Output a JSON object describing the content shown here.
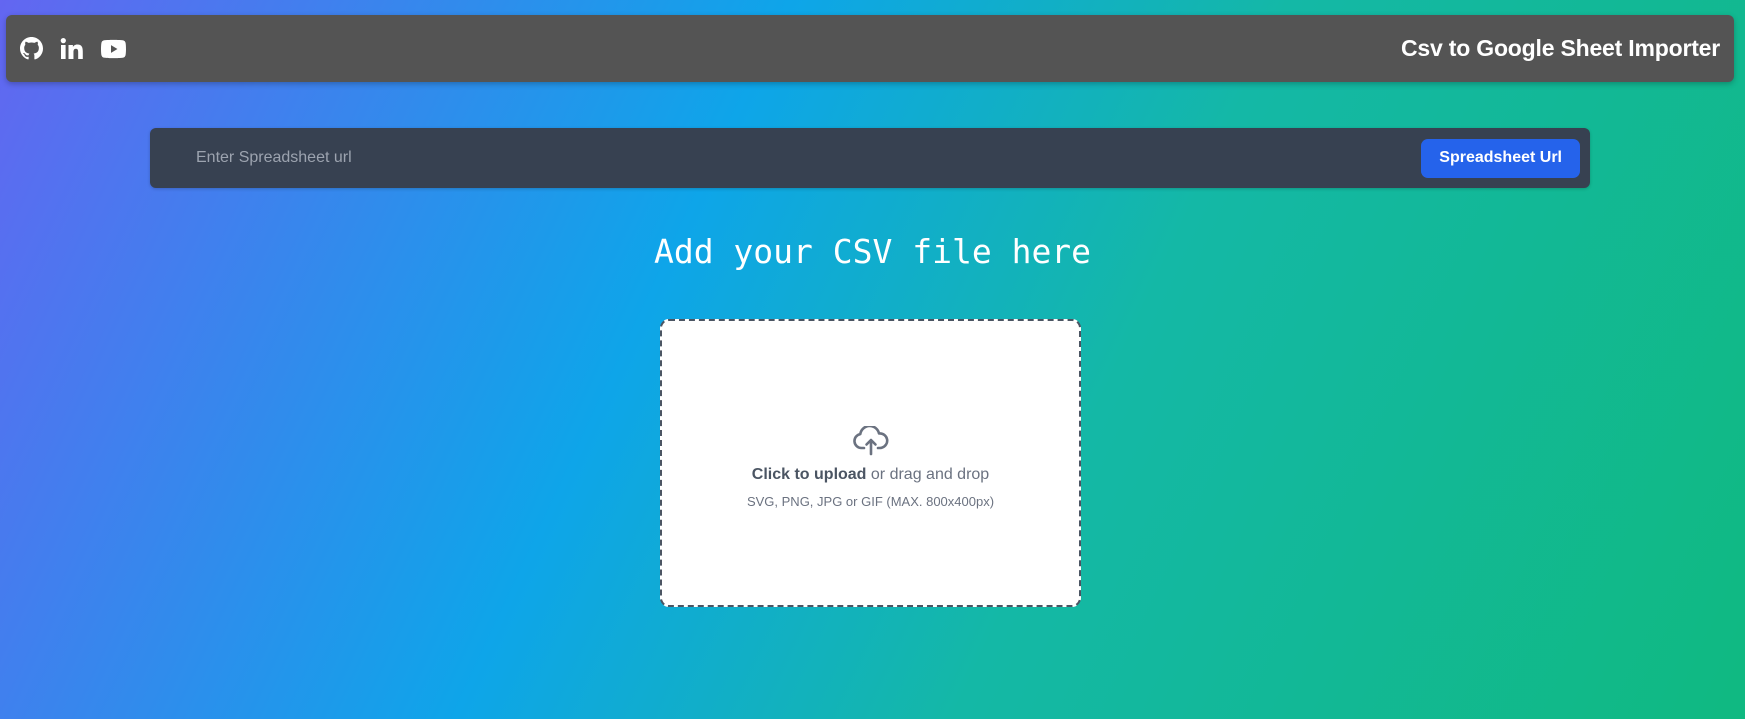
{
  "header": {
    "title": "Csv to Google Sheet Importer",
    "social_icons": [
      "github-icon",
      "linkedin-icon",
      "youtube-icon"
    ]
  },
  "url_bar": {
    "placeholder": "Enter Spreadsheet url",
    "value": "",
    "button_label": "Spreadsheet Url"
  },
  "main": {
    "heading": "Add your CSV file here"
  },
  "dropzone": {
    "icon": "cloud-upload-icon",
    "click_text": "Click to upload",
    "drag_text": " or drag and drop",
    "hint": "SVG, PNG, JPG or GIF (MAX. 800x400px)"
  },
  "colors": {
    "navbar": "#545454",
    "url_bar": "#374151",
    "button": "#2563eb",
    "gradient_start": "#6366f1",
    "gradient_mid": "#0ea5e9",
    "gradient_end": "#10b981"
  }
}
